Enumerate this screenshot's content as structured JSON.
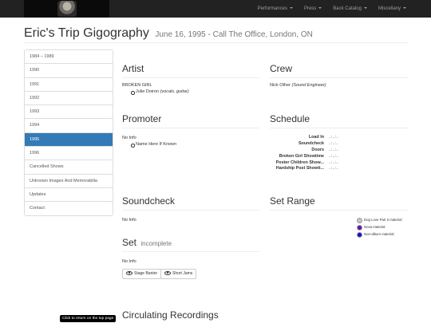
{
  "nav": {
    "items": [
      {
        "label": "Performances"
      },
      {
        "label": "Press"
      },
      {
        "label": "Back Catalog"
      },
      {
        "label": "Miscellany"
      }
    ]
  },
  "page": {
    "title": "Eric's Trip Gigography",
    "subtitle": "June 16, 1995 - Call The Office, London, ON"
  },
  "sidebar": {
    "items": [
      {
        "label": "1984 – 1989"
      },
      {
        "label": "1990"
      },
      {
        "label": "1991"
      },
      {
        "label": "1992"
      },
      {
        "label": "1993"
      },
      {
        "label": "1994"
      },
      {
        "label": "1995",
        "active": true
      },
      {
        "label": "1996"
      },
      {
        "label": "Cancelled Shows"
      },
      {
        "label": "Unknown Images And Memorabilia"
      },
      {
        "label": "Updates"
      },
      {
        "label": "Contact"
      }
    ]
  },
  "artist": {
    "heading": "Artist",
    "band": "BROKEN GIRL",
    "member_name": "Julie Doiron",
    "member_role": "(vocals, guitar)"
  },
  "crew": {
    "heading": "Crew",
    "name": "Nick Other",
    "role": "(Sound Engineer)"
  },
  "promoter": {
    "heading": "Promoter",
    "info": "No Info",
    "name": "Name Here If Known"
  },
  "schedule": {
    "heading": "Schedule",
    "rows": [
      {
        "label": "Load In",
        "value": "..:..:.."
      },
      {
        "label": "Soundcheck",
        "value": "..:..:.."
      },
      {
        "label": "Doors",
        "value": "..:..:.."
      },
      {
        "label": "Broken Girl Showtime",
        "value": "..:..:.."
      },
      {
        "label": "Poster Children Show...",
        "value": "..:..:.."
      },
      {
        "label": "Hardship Post Showti...",
        "value": "..:..:.."
      }
    ]
  },
  "soundcheck": {
    "heading": "Soundcheck",
    "info": "No Info"
  },
  "set_range": {
    "heading": "Set Range",
    "legend": [
      {
        "label": "Dog Love Part II material",
        "color": "#c8c8c8"
      },
      {
        "label": "Nova material",
        "color": "#6a0dad"
      },
      {
        "label": "Non-album material",
        "color": "#1010d0"
      }
    ]
  },
  "set": {
    "heading": "Set",
    "status": "incomplete",
    "info": "No Info",
    "buttons": {
      "stage_banter": "Stage Banter",
      "short_jams": "Short Jams"
    }
  },
  "recordings": {
    "heading": "Circulating Recordings"
  },
  "tooltip": "Click to return on the top page"
}
